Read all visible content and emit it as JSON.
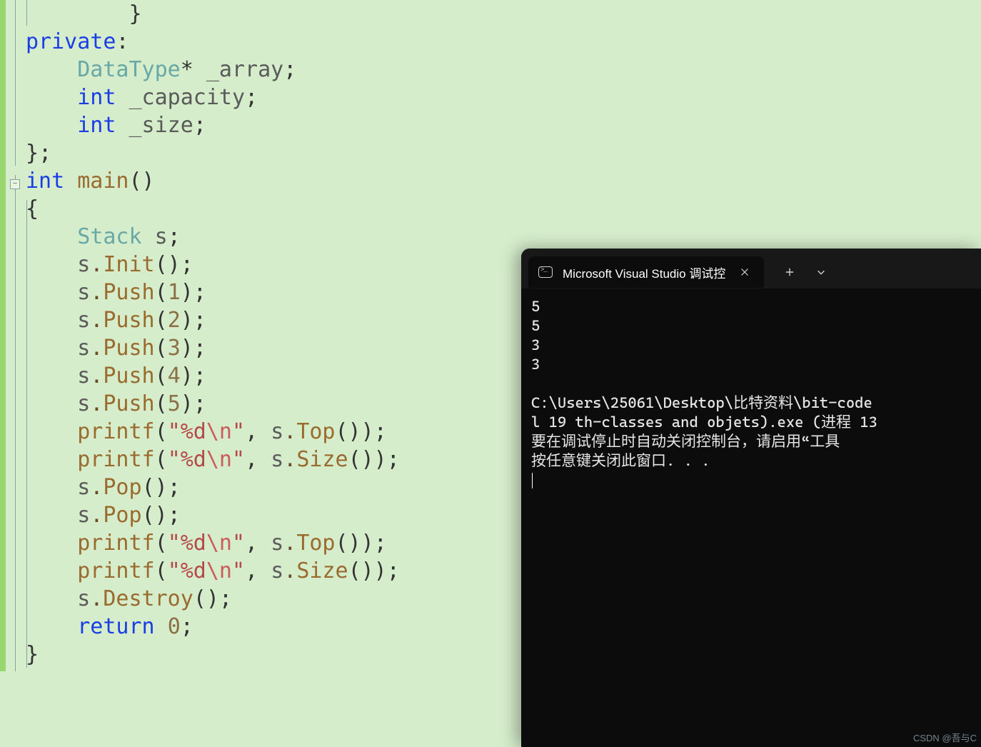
{
  "editor": {
    "tokens": [
      [
        [
          "        ",
          "plain"
        ],
        [
          "}",
          "punct"
        ]
      ],
      [
        [
          "",
          "plain"
        ],
        [
          "private",
          "kw"
        ],
        [
          ":",
          "punct"
        ]
      ],
      [
        [
          "    ",
          "plain"
        ],
        [
          "DataType",
          "typeuser"
        ],
        [
          "* ",
          "punct"
        ],
        [
          "_array",
          "var"
        ],
        [
          ";",
          "punct"
        ]
      ],
      [
        [
          "    ",
          "plain"
        ],
        [
          "int",
          "kw"
        ],
        [
          " ",
          "plain"
        ],
        [
          "_capacity",
          "var"
        ],
        [
          ";",
          "punct"
        ]
      ],
      [
        [
          "    ",
          "plain"
        ],
        [
          "int",
          "kw"
        ],
        [
          " ",
          "plain"
        ],
        [
          "_size",
          "var"
        ],
        [
          ";",
          "punct"
        ]
      ],
      [
        [
          "",
          "plain"
        ],
        [
          "}",
          "punct"
        ],
        [
          ";",
          "punct"
        ]
      ],
      [
        [
          "",
          "plain"
        ],
        [
          "int",
          "kw"
        ],
        [
          " ",
          "plain"
        ],
        [
          "main",
          "method"
        ],
        [
          "()",
          "punct"
        ]
      ],
      [
        [
          "",
          "plain"
        ],
        [
          "{",
          "punct"
        ]
      ],
      [
        [
          "    ",
          "plain"
        ],
        [
          "Stack",
          "typeuser"
        ],
        [
          " ",
          "plain"
        ],
        [
          "s",
          "var"
        ],
        [
          ";",
          "punct"
        ]
      ],
      [
        [
          "    ",
          "plain"
        ],
        [
          "s",
          "var"
        ],
        [
          ".",
          "op"
        ],
        [
          "Init",
          "method"
        ],
        [
          "()",
          "punct"
        ],
        [
          ";",
          "punct"
        ]
      ],
      [
        [
          "    ",
          "plain"
        ],
        [
          "s",
          "var"
        ],
        [
          ".",
          "op"
        ],
        [
          "Push",
          "method"
        ],
        [
          "(",
          "punct"
        ],
        [
          "1",
          "num"
        ],
        [
          ")",
          "punct"
        ],
        [
          ";",
          "punct"
        ]
      ],
      [
        [
          "    ",
          "plain"
        ],
        [
          "s",
          "var"
        ],
        [
          ".",
          "op"
        ],
        [
          "Push",
          "method"
        ],
        [
          "(",
          "punct"
        ],
        [
          "2",
          "num"
        ],
        [
          ")",
          "punct"
        ],
        [
          ";",
          "punct"
        ]
      ],
      [
        [
          "    ",
          "plain"
        ],
        [
          "s",
          "var"
        ],
        [
          ".",
          "op"
        ],
        [
          "Push",
          "method"
        ],
        [
          "(",
          "punct"
        ],
        [
          "3",
          "num"
        ],
        [
          ")",
          "punct"
        ],
        [
          ";",
          "punct"
        ]
      ],
      [
        [
          "    ",
          "plain"
        ],
        [
          "s",
          "var"
        ],
        [
          ".",
          "op"
        ],
        [
          "Push",
          "method"
        ],
        [
          "(",
          "punct"
        ],
        [
          "4",
          "num"
        ],
        [
          ")",
          "punct"
        ],
        [
          ";",
          "punct"
        ]
      ],
      [
        [
          "    ",
          "plain"
        ],
        [
          "s",
          "var"
        ],
        [
          ".",
          "op"
        ],
        [
          "Push",
          "method"
        ],
        [
          "(",
          "punct"
        ],
        [
          "5",
          "num"
        ],
        [
          ")",
          "punct"
        ],
        [
          ";",
          "punct"
        ]
      ],
      [
        [
          "    ",
          "plain"
        ],
        [
          "printf",
          "method"
        ],
        [
          "(",
          "punct"
        ],
        [
          "\"%d",
          "str"
        ],
        [
          "\\n",
          "esc"
        ],
        [
          "\"",
          "str"
        ],
        [
          ", ",
          "punct"
        ],
        [
          "s",
          "var"
        ],
        [
          ".",
          "op"
        ],
        [
          "Top",
          "method"
        ],
        [
          "())",
          "punct"
        ],
        [
          ";",
          "punct"
        ]
      ],
      [
        [
          "    ",
          "plain"
        ],
        [
          "printf",
          "method"
        ],
        [
          "(",
          "punct"
        ],
        [
          "\"%d",
          "str"
        ],
        [
          "\\n",
          "esc"
        ],
        [
          "\"",
          "str"
        ],
        [
          ", ",
          "punct"
        ],
        [
          "s",
          "var"
        ],
        [
          ".",
          "op"
        ],
        [
          "Size",
          "method"
        ],
        [
          "())",
          "punct"
        ],
        [
          ";",
          "punct"
        ]
      ],
      [
        [
          "    ",
          "plain"
        ],
        [
          "s",
          "var"
        ],
        [
          ".",
          "op"
        ],
        [
          "Pop",
          "method"
        ],
        [
          "()",
          "punct"
        ],
        [
          ";",
          "punct"
        ]
      ],
      [
        [
          "    ",
          "plain"
        ],
        [
          "s",
          "var"
        ],
        [
          ".",
          "op"
        ],
        [
          "Pop",
          "method"
        ],
        [
          "()",
          "punct"
        ],
        [
          ";",
          "punct"
        ]
      ],
      [
        [
          "    ",
          "plain"
        ],
        [
          "printf",
          "method"
        ],
        [
          "(",
          "punct"
        ],
        [
          "\"%d",
          "str"
        ],
        [
          "\\n",
          "esc"
        ],
        [
          "\"",
          "str"
        ],
        [
          ", ",
          "punct"
        ],
        [
          "s",
          "var"
        ],
        [
          ".",
          "op"
        ],
        [
          "Top",
          "method"
        ],
        [
          "())",
          "punct"
        ],
        [
          ";",
          "punct"
        ]
      ],
      [
        [
          "    ",
          "plain"
        ],
        [
          "printf",
          "method"
        ],
        [
          "(",
          "punct"
        ],
        [
          "\"%d",
          "str"
        ],
        [
          "\\n",
          "esc"
        ],
        [
          "\"",
          "str"
        ],
        [
          ", ",
          "punct"
        ],
        [
          "s",
          "var"
        ],
        [
          ".",
          "op"
        ],
        [
          "Size",
          "method"
        ],
        [
          "())",
          "punct"
        ],
        [
          ";",
          "punct"
        ]
      ],
      [
        [
          "    ",
          "plain"
        ],
        [
          "s",
          "var"
        ],
        [
          ".",
          "op"
        ],
        [
          "Destroy",
          "method"
        ],
        [
          "()",
          "punct"
        ],
        [
          ";",
          "punct"
        ]
      ],
      [
        [
          "    ",
          "plain"
        ],
        [
          "return",
          "kw"
        ],
        [
          " ",
          "plain"
        ],
        [
          "0",
          "num"
        ],
        [
          ";",
          "punct"
        ]
      ],
      [
        [
          "",
          "plain"
        ],
        [
          "}",
          "punct"
        ]
      ]
    ],
    "fold_button_label": "−"
  },
  "terminal": {
    "tab_title": "Microsoft Visual Studio 调试控",
    "output_lines": [
      "5",
      "5",
      "3",
      "3",
      "",
      "C:\\Users\\25061\\Desktop\\比特资料\\bit-code",
      "l 19 th-classes and objets).exe (进程 13",
      "要在调试停止时自动关闭控制台，请启用“工具",
      "按任意键关闭此窗口. . ."
    ]
  },
  "watermark": "CSDN @吾与C"
}
